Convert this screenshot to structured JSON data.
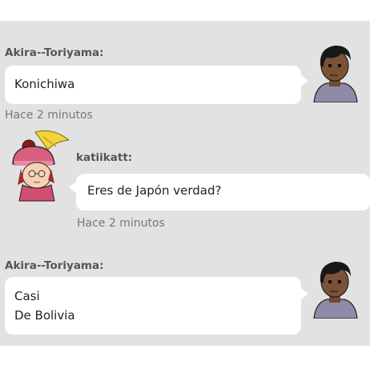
{
  "chat": {
    "messages": [
      {
        "sender": "Akira--Toriyama:",
        "lines": [
          "Konichiwa"
        ],
        "time": "Hace 2 minutos",
        "avatar": "boy-avatar-icon"
      },
      {
        "sender": "katiikatt:",
        "lines": [
          "Eres de Japón verdad?"
        ],
        "time": "Hace 2 minutos",
        "avatar": "girl-avatar-icon"
      },
      {
        "sender": "Akira--Toriyama:",
        "lines": [
          "Casi",
          "De Bolivia"
        ],
        "avatar": "boy-avatar-icon"
      }
    ]
  },
  "colors": {
    "background": "#e2e2e2",
    "bubble": "#ffffff",
    "sender_text": "#555555",
    "timestamp_text": "#777777"
  }
}
